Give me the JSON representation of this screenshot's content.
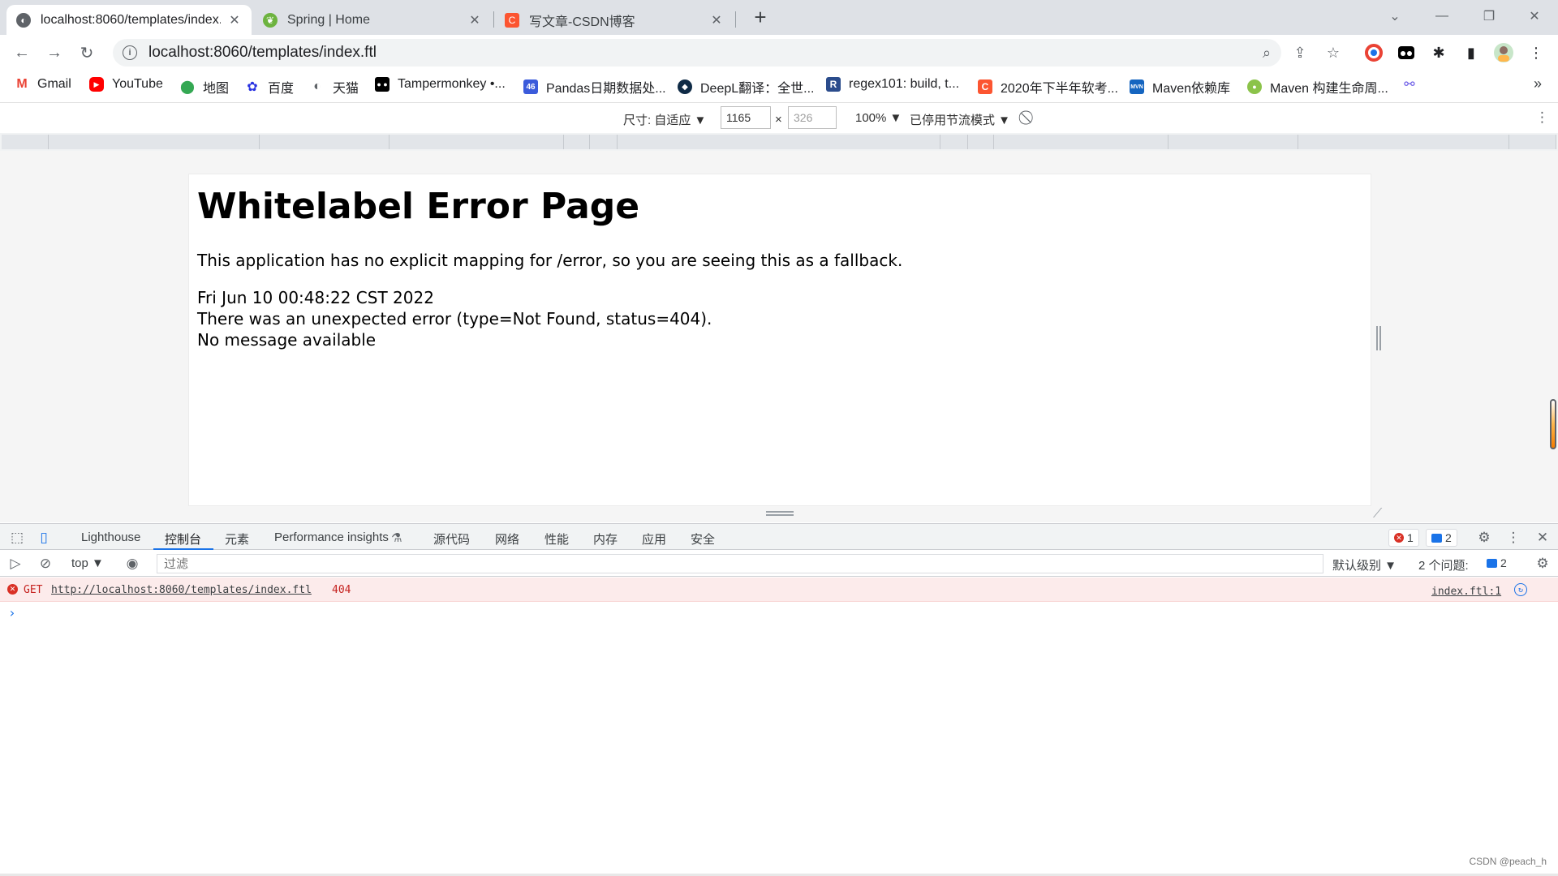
{
  "tabs": [
    {
      "title": "localhost:8060/templates/index.ftl",
      "favicon": "globe-icon"
    },
    {
      "title": "Spring | Home",
      "favicon": "spring-leaf-icon"
    },
    {
      "title": "写文章-CSDN博客",
      "favicon": "csdn-icon"
    }
  ],
  "address": {
    "url": "localhost:8060/templates/index.ftl"
  },
  "bookmarks": [
    {
      "label": "Gmail",
      "icon": "gmail-icon",
      "color": "#ea4335"
    },
    {
      "label": "YouTube",
      "icon": "youtube-icon",
      "color": "#ff0000"
    },
    {
      "label": "地图",
      "icon": "maps-pin-icon",
      "color": "#34a853"
    },
    {
      "label": "百度",
      "icon": "baidu-icon",
      "color": "#2932e1"
    },
    {
      "label": "天猫",
      "icon": "globe-icon",
      "color": "#5f6368"
    },
    {
      "label": "Tampermonkey •...",
      "icon": "tampermonkey-icon",
      "color": "#000000"
    },
    {
      "label": "Pandas日期数据处...",
      "icon": "pandas-icon",
      "color": "#3b5bdb"
    },
    {
      "label": "DeepL翻译：全世...",
      "icon": "deepl-icon",
      "color": "#0f2b46"
    },
    {
      "label": "regex101: build, t...",
      "icon": "regex101-icon",
      "color": "#2b4c8c"
    },
    {
      "label": "2020年下半年软考...",
      "icon": "csdn-icon",
      "color": "#fc5531"
    },
    {
      "label": "Maven依赖库",
      "icon": "maven-icon",
      "color": "#1565c0"
    },
    {
      "label": "Maven 构建生命周...",
      "icon": "runoob-icon",
      "color": "#8bc34a"
    }
  ],
  "device_toolbar": {
    "dimensions_label": "尺寸: 自适应 ▼",
    "width": "1165",
    "height": "326",
    "times": "×",
    "zoom": "100% ▼",
    "throttle": "已停用节流模式 ▼"
  },
  "page": {
    "heading": "Whitelabel Error Page",
    "intro": "This application has no explicit mapping for /error, so you are seeing this as a fallback.",
    "timestamp": "Fri Jun 10 00:48:22 CST 2022",
    "error": "There was an unexpected error (type=Not Found, status=404).",
    "message": "No message available"
  },
  "devtools": {
    "tabs": [
      "Lighthouse",
      "控制台",
      "元素",
      "Performance insights",
      "源代码",
      "网络",
      "性能",
      "内存",
      "应用",
      "安全"
    ],
    "active_tab": "控制台",
    "error_count": "1",
    "message_count": "2",
    "context": "top ▼",
    "filter_placeholder": "过滤",
    "level": "默认级别 ▼",
    "issues_label": "2 个问题:",
    "issues_count": "2",
    "console_error": {
      "method": "GET",
      "url": "http://localhost:8060/templates/index.ftl",
      "status": "404",
      "source": "index.ftl:1"
    }
  },
  "watermark": "CSDN @peach_h"
}
